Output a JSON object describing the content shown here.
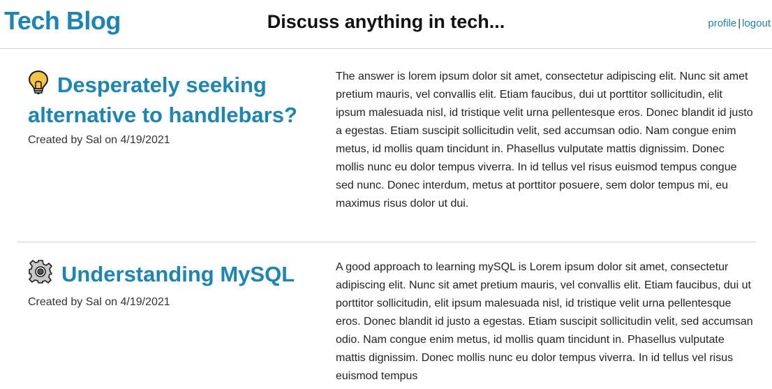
{
  "header": {
    "brand": "Tech Blog",
    "tagline": "Discuss anything in tech...",
    "nav": {
      "profile": "profile",
      "separator": "|",
      "logout": "logout"
    }
  },
  "posts": [
    {
      "icon": "lightbulb-icon",
      "title": "Desperately seeking alternative to handlebars?",
      "meta": "Created by Sal on 4/19/2021",
      "body": "The answer is lorem ipsum dolor sit amet, consectetur adipiscing elit. Nunc sit amet pretium mauris, vel convallis elit. Etiam faucibus, dui ut porttitor sollicitudin, elit ipsum malesuada nisl, id tristique velit urna pellentesque eros. Donec blandit id justo a egestas. Etiam suscipit sollicitudin velit, sed accumsan odio. Nam congue enim metus, id mollis quam tincidunt in. Phasellus vulputate mattis dignissim. Donec mollis nunc eu dolor tempus viverra. In id tellus vel risus euismod tempus congue sed nunc. Donec interdum, metus at porttitor posuere, sem dolor tempus mi, eu maximus risus dolor ut dui."
    },
    {
      "icon": "gear-icon",
      "title": "Understanding MySQL",
      "meta": "Created by Sal on 4/19/2021",
      "body": "A good approach to learning mySQL is Lorem ipsum dolor sit amet, consectetur adipiscing elit. Nunc sit amet pretium mauris, vel convallis elit. Etiam faucibus, dui ut porttitor sollicitudin, elit ipsum malesuada nisl, id tristique velit urna pellentesque eros. Donec blandit id justo a egestas. Etiam suscipit sollicitudin velit, sed accumsan odio. Nam congue enim metus, id mollis quam tincidunt in. Phasellus vulputate mattis dignissim. Donec mollis nunc eu dolor tempus viverra. In id tellus vel risus euismod tempus"
    }
  ]
}
